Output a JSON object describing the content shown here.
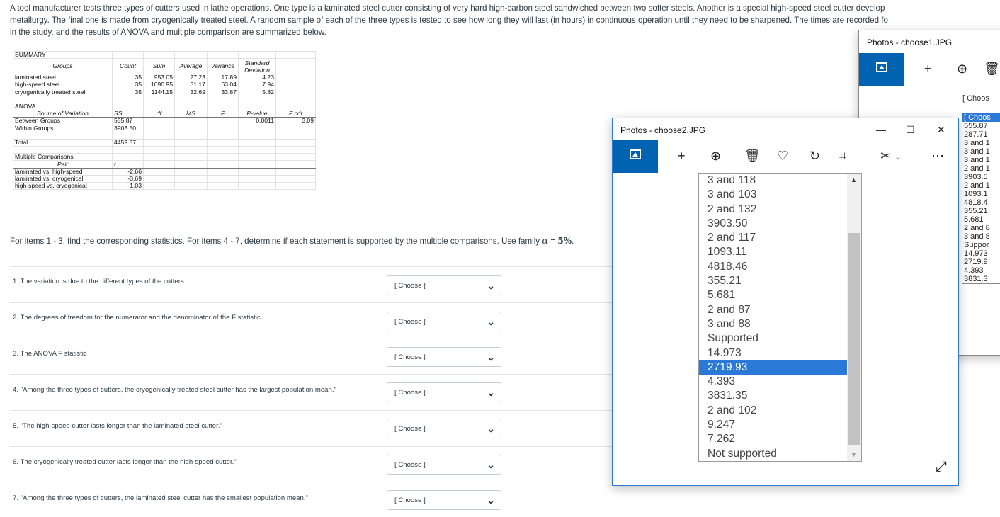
{
  "intro": {
    "line1": "A tool manufacturer tests three types of cutters used in lathe operations. One type is a laminated steel cutter consisting of very hard high-carbon steel sandwiched between two softer steels. Another is a special high-speed steel cutter develop",
    "line2": "metallurgy. The final one is made from cryogenically treated steel. A random sample of each of the three types is tested to see how long they will last (in hours) in continuous operation until they need to be sharpened. The times are recorded fo",
    "line3": "in the study, and the results of ANOVA and multiple comparison are summarized below."
  },
  "summary": {
    "title": "SUMMARY",
    "headers": [
      "Groups",
      "Count",
      "Sum",
      "Average",
      "Variance",
      "Standard Deviation"
    ],
    "rows": [
      [
        "laminated steel",
        "35",
        "953.05",
        "27.23",
        "17.89",
        "4.23"
      ],
      [
        "high-speed steel",
        "35",
        "1090.95",
        "31.17",
        "63.04",
        "7.94"
      ],
      [
        "cryogenically treated steel",
        "35",
        "1144.15",
        "32.69",
        "33.87",
        "5.82"
      ]
    ]
  },
  "anova": {
    "title": "ANOVA",
    "headers": [
      "Source of Variation",
      "SS",
      "df",
      "MS",
      "F",
      "P-value",
      "F crit"
    ],
    "rows": [
      [
        "Between Groups",
        "555.87",
        "",
        "",
        "",
        "0.0011",
        "3.09"
      ],
      [
        "Within Groups",
        "3903.50",
        "",
        "",
        "",
        "",
        ""
      ]
    ],
    "total": [
      "Total",
      "4459.37"
    ]
  },
  "multiple": {
    "title": "Multiple Comparisons",
    "headers": [
      "Pair",
      "t"
    ],
    "rows": [
      [
        "laminated vs. high-speed",
        "-2.66"
      ],
      [
        "laminated vs. cryogenical",
        "-3.69"
      ],
      [
        "high-speed vs. cryogenical",
        "-1.03"
      ]
    ]
  },
  "instructions": {
    "text": "For items 1 - 3, find the corresponding statistics. For items  4 - 7, determine if each statement is supported by the multiple comparisons. Use family",
    "alpha": "α",
    "equals": " = ",
    "pct": "5%",
    "end": "."
  },
  "questions": [
    {
      "text": "1. The variation is due to the different types of the cutters",
      "select": "[ Choose ]"
    },
    {
      "text": "2. The degrees of freedom for the numerator and the denominator of the F statistic",
      "select": "[ Choose ]"
    },
    {
      "text": "3. The ANOVA F statistic",
      "select": "[ Choose ]"
    },
    {
      "text": "4. \"Among the three types of cutters, the cryogenically treated steel cutter has the largest population mean.\"",
      "select": "[ Choose ]"
    },
    {
      "text": "5. \"The high-speed cutter lasts longer than the laminated steel cutter.\"",
      "select": "[ Choose ]"
    },
    {
      "text": "6. The cryogenically treated cutter lasts longer than the high-speed cutter.\"",
      "select": "[ Choose ]"
    },
    {
      "text": "7. \"Among the three types of cutters, the laminated steel cutter has the smallest population mean.\"",
      "select": "[ Choose ]"
    }
  ],
  "back_window": {
    "title": "Photos - choose1.JPG",
    "list_top": "[ Choos",
    "options": [
      "[ Choos",
      "555.87",
      "287.71",
      "3 and 1",
      "3 and 1",
      "3 and 1",
      "2 and 1",
      "3903.5",
      "2 and 1",
      "1093.1",
      "4818.4",
      "355.21",
      "5.681",
      "2 and 8",
      "3 and 8",
      "Suppor",
      "14.973",
      "2719.9",
      "4.393",
      "3831.3"
    ]
  },
  "front_window": {
    "title": "Photos - choose2.JPG",
    "minimize": "—",
    "maximize": "☐",
    "close": "✕",
    "options": [
      "3 and 118",
      "3 and 103",
      "2 and 132",
      "3903.50",
      "2 and 117",
      "1093.11",
      "4818.46",
      "355.21",
      "5.681",
      "2 and 87",
      "3 and 88",
      "Supported",
      "14.973",
      "2719.93",
      "4.393",
      "3831.35",
      "2 and 102",
      "9.247",
      "7.262",
      "Not supported"
    ],
    "selected_index": 13
  },
  "colors": {
    "accent": "#0063b1",
    "selection": "#2b79d6",
    "text": "#2d3b45"
  }
}
